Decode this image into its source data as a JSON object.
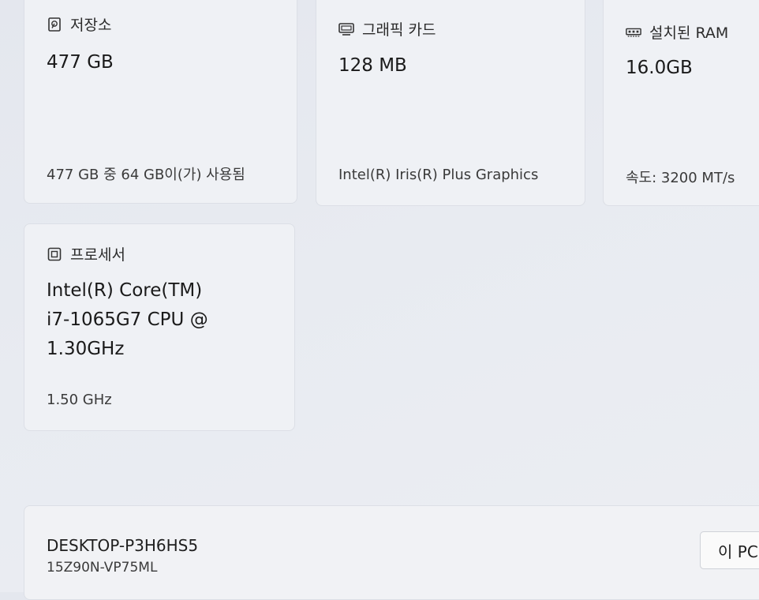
{
  "storage": {
    "title": "저장소",
    "value": "477 GB",
    "detail": "477 GB 중 64 GB이(가) 사용됨",
    "icon": "storage-drive-icon"
  },
  "graphics": {
    "title": "그래픽 카드",
    "value": "128 MB",
    "detail": "Intel(R) Iris(R) Plus Graphics",
    "icon": "display-adapter-icon"
  },
  "ram": {
    "title": "설치된 RAM",
    "value": "16.0GB",
    "detail": "속도: 3200 MT/s",
    "icon": "memory-module-icon"
  },
  "processor": {
    "title": "프로세서",
    "value_lines": [
      "Intel(R) Core(TM)",
      "i7-1065G7 CPU @",
      "1.30GHz"
    ],
    "detail": "1.50 GHz",
    "icon": "cpu-chip-icon"
  },
  "device": {
    "name": "DESKTOP-P3H6HS5",
    "model": "15Z90N-VP75ML",
    "rename_label": "이 PC"
  }
}
